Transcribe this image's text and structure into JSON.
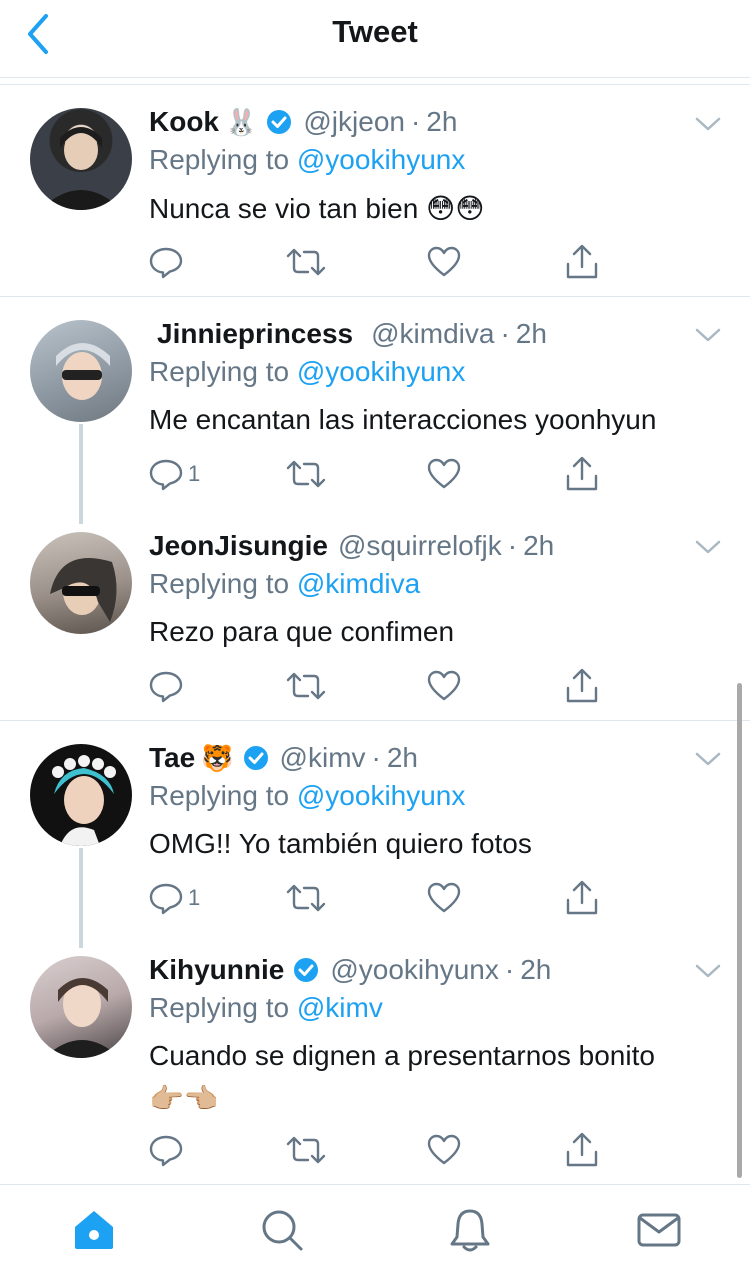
{
  "header": {
    "title": "Tweet"
  },
  "reply_prefix": "Replying to",
  "tweets": [
    {
      "name": "Kook",
      "emoji": "🐰",
      "handle": "@jkjeon",
      "time": "2h",
      "replying_to": "@yookihyunx",
      "text": "Nunca se vio tan bien 😳😳",
      "text2": "",
      "reply_count": ""
    },
    {
      "name": "Jinnieprincess",
      "emoji": "",
      "handle": "@kimdiva",
      "time": "2h",
      "replying_to": "@yookihyunx",
      "text": "Me encantan las interacciones yoonhyun",
      "text2": "",
      "reply_count": "1"
    },
    {
      "name": "JeonJisungie",
      "emoji": "",
      "handle": "@squirrelofjk",
      "time": "2h",
      "replying_to": "@kimdiva",
      "text": "Rezo para que confimen",
      "text2": "",
      "reply_count": ""
    },
    {
      "name": "Tae",
      "emoji": "🐯",
      "handle": "@kimv",
      "time": "2h",
      "replying_to": "@yookihyunx",
      "text": "OMG!! Yo también quiero fotos",
      "text2": "",
      "reply_count": "1"
    },
    {
      "name": "Kihyunnie",
      "emoji": "",
      "handle": "@yookihyunx",
      "time": "2h",
      "replying_to": "@kimv",
      "text": "Cuando se dignen a presentarnos bonito",
      "text2": "👉🏼👈🏼",
      "reply_count": ""
    }
  ],
  "tabbar": [
    "home-icon",
    "search-icon",
    "bell-icon",
    "mail-icon"
  ],
  "colors": {
    "accent": "#1da1f2",
    "muted": "#657786",
    "text": "#14171a",
    "divider": "#e1e8ed"
  }
}
